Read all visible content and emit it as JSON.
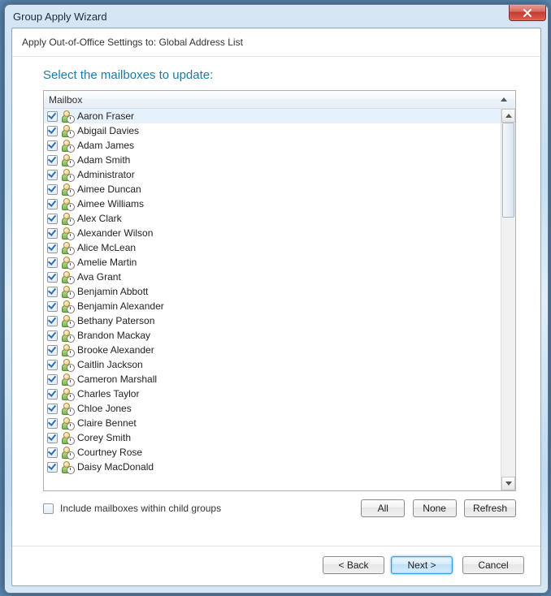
{
  "window": {
    "title": "Group Apply Wizard"
  },
  "subheader": "Apply Out-of-Office Settings to: Global Address List",
  "section_title": "Select the mailboxes to update:",
  "list": {
    "column_label": "Mailbox",
    "items": [
      {
        "name": "Aaron Fraser",
        "checked": true,
        "selected": true
      },
      {
        "name": "Abigail Davies",
        "checked": true
      },
      {
        "name": "Adam James",
        "checked": true
      },
      {
        "name": "Adam Smith",
        "checked": true
      },
      {
        "name": "Administrator",
        "checked": true
      },
      {
        "name": "Aimee Duncan",
        "checked": true
      },
      {
        "name": "Aimee Williams",
        "checked": true
      },
      {
        "name": "Alex Clark",
        "checked": true
      },
      {
        "name": "Alexander Wilson",
        "checked": true
      },
      {
        "name": "Alice McLean",
        "checked": true
      },
      {
        "name": "Amelie Martin",
        "checked": true
      },
      {
        "name": "Ava Grant",
        "checked": true
      },
      {
        "name": "Benjamin Abbott",
        "checked": true
      },
      {
        "name": "Benjamin Alexander",
        "checked": true
      },
      {
        "name": "Bethany Paterson",
        "checked": true
      },
      {
        "name": "Brandon Mackay",
        "checked": true
      },
      {
        "name": "Brooke Alexander",
        "checked": true
      },
      {
        "name": "Caitlin Jackson",
        "checked": true
      },
      {
        "name": "Cameron Marshall",
        "checked": true
      },
      {
        "name": "Charles Taylor",
        "checked": true
      },
      {
        "name": "Chloe Jones",
        "checked": true
      },
      {
        "name": "Claire Bennet",
        "checked": true
      },
      {
        "name": "Corey Smith",
        "checked": true
      },
      {
        "name": "Courtney Rose",
        "checked": true
      },
      {
        "name": "Daisy MacDonald",
        "checked": true
      }
    ]
  },
  "include_child_groups": {
    "label": "Include mailboxes within child groups",
    "checked": false
  },
  "buttons": {
    "all": "All",
    "none": "None",
    "refresh": "Refresh",
    "back": "< Back",
    "next": "Next >",
    "cancel": "Cancel"
  }
}
